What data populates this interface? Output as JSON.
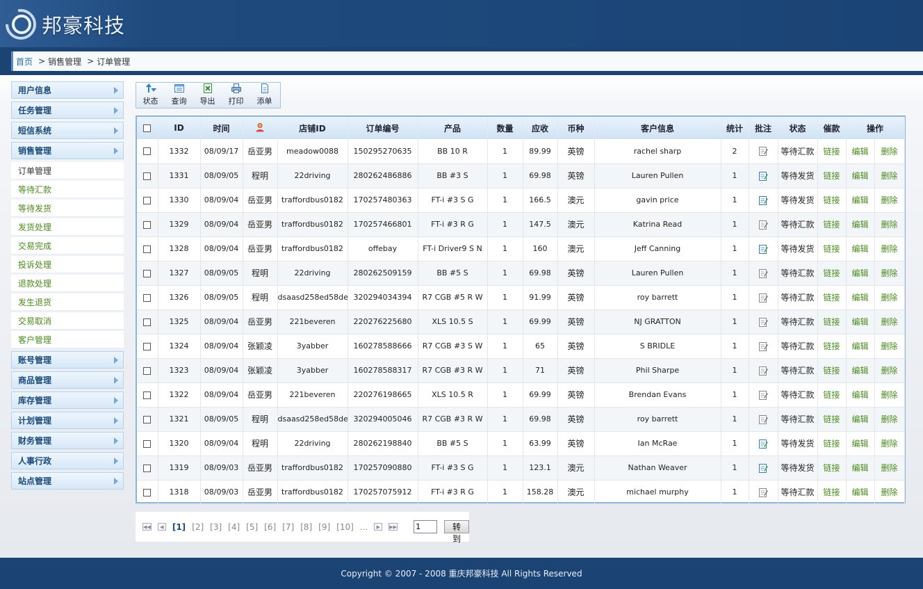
{
  "header": {
    "logo_text": "邦豪科技"
  },
  "breadcrumb": {
    "home": "首页",
    "sep": ">",
    "level1": "销售管理",
    "level2": "订单管理"
  },
  "sidebar": {
    "top_menus": [
      "用户信息",
      "任务管理",
      "短信系统",
      "销售管理"
    ],
    "sub_items": [
      "订单管理",
      "等待汇款",
      "等待发货",
      "发货处理",
      "交易完成",
      "投诉处理",
      "退款处理",
      "发生退货",
      "交易取消",
      "客户管理"
    ],
    "bottom_menus": [
      "账号管理",
      "商品管理",
      "库存管理",
      "计划管理",
      "财务管理",
      "人事行政",
      "站点管理"
    ]
  },
  "toolbar": {
    "status": "状态",
    "query": "查询",
    "export": "导出",
    "print": "打印",
    "add": "添单"
  },
  "table": {
    "headers": {
      "id": "ID",
      "time": "时间",
      "shop_id": "店铺ID",
      "order_no": "订单编号",
      "product": "产品",
      "qty": "数量",
      "receivable": "应收",
      "currency": "币种",
      "customer": "客户信息",
      "stats": "统计",
      "note": "批注",
      "status": "状态",
      "urge": "催款",
      "ops": "操作"
    },
    "rows": [
      {
        "id": "1332",
        "time": "08/09/17",
        "user": "岳亚男",
        "shop": "meadow0088",
        "order": "150295270635",
        "product": "BB 10 R",
        "qty": "1",
        "amount": "89.99",
        "currency": "英镑",
        "customer": "rachel sharp",
        "stats": "2",
        "note": "gray",
        "status": "等待汇款",
        "urge": "链接",
        "edit": "编辑",
        "del": "删除"
      },
      {
        "id": "1331",
        "time": "08/09/05",
        "user": "程明",
        "shop": "22driving",
        "order": "280262486886",
        "product": "BB #3 S",
        "qty": "1",
        "amount": "69.98",
        "currency": "英镑",
        "customer": "Lauren Pullen",
        "stats": "1",
        "note": "color",
        "status": "等待发货",
        "urge": "链接",
        "edit": "编辑",
        "del": "删除"
      },
      {
        "id": "1330",
        "time": "08/09/04",
        "user": "岳亚男",
        "shop": "traffordbus0182",
        "order": "170257480363",
        "product": "FT-i #3 S G",
        "qty": "1",
        "amount": "166.5",
        "currency": "澳元",
        "customer": "gavin price",
        "stats": "1",
        "note": "color",
        "status": "等待发货",
        "urge": "链接",
        "edit": "编辑",
        "del": "删除"
      },
      {
        "id": "1329",
        "time": "08/09/04",
        "user": "岳亚男",
        "shop": "traffordbus0182",
        "order": "170257466801",
        "product": "FT-i #3 R G",
        "qty": "1",
        "amount": "147.5",
        "currency": "澳元",
        "customer": "Katrina Read",
        "stats": "1",
        "note": "gray",
        "status": "等待汇款",
        "urge": "链接",
        "edit": "编辑",
        "del": "删除"
      },
      {
        "id": "1328",
        "time": "08/09/04",
        "user": "岳亚男",
        "shop": "traffordbus0182",
        "order": "offebay",
        "product": "FT-i Driver9 S N",
        "qty": "1",
        "amount": "160",
        "currency": "澳元",
        "customer": "Jeff Canning",
        "stats": "1",
        "note": "color",
        "status": "等待发货",
        "urge": "链接",
        "edit": "编辑",
        "del": "删除"
      },
      {
        "id": "1327",
        "time": "08/09/05",
        "user": "程明",
        "shop": "22driving",
        "order": "280262509159",
        "product": "BB #5 S",
        "qty": "1",
        "amount": "69.98",
        "currency": "英镑",
        "customer": "Lauren Pullen",
        "stats": "1",
        "note": "gray",
        "status": "等待汇款",
        "urge": "链接",
        "edit": "编辑",
        "del": "删除"
      },
      {
        "id": "1326",
        "time": "08/09/05",
        "user": "程明",
        "shop": "dsaasd258ed58de",
        "order": "320294034394",
        "product": "R7 CGB #5 R W",
        "qty": "1",
        "amount": "91.99",
        "currency": "英镑",
        "customer": "roy barrett",
        "stats": "1",
        "note": "gray",
        "status": "等待汇款",
        "urge": "链接",
        "edit": "编辑",
        "del": "删除"
      },
      {
        "id": "1325",
        "time": "08/09/04",
        "user": "岳亚男",
        "shop": "221beveren",
        "order": "220276225680",
        "product": "XLS 10.5 S",
        "qty": "1",
        "amount": "69.99",
        "currency": "英镑",
        "customer": "NJ GRATTON",
        "stats": "1",
        "note": "gray",
        "status": "等待汇款",
        "urge": "链接",
        "edit": "编辑",
        "del": "删除"
      },
      {
        "id": "1324",
        "time": "08/09/04",
        "user": "张颖凌",
        "shop": "3yabber",
        "order": "160278588666",
        "product": "R7 CGB #3 S W",
        "qty": "1",
        "amount": "65",
        "currency": "英镑",
        "customer": "S BRIDLE",
        "stats": "1",
        "note": "gray",
        "status": "等待汇款",
        "urge": "链接",
        "edit": "编辑",
        "del": "删除"
      },
      {
        "id": "1323",
        "time": "08/09/04",
        "user": "张颖凌",
        "shop": "3yabber",
        "order": "160278588317",
        "product": "R7 CGB #3 R W",
        "qty": "1",
        "amount": "71",
        "currency": "英镑",
        "customer": "Phil Sharpe",
        "stats": "1",
        "note": "gray",
        "status": "等待汇款",
        "urge": "链接",
        "edit": "编辑",
        "del": "删除"
      },
      {
        "id": "1322",
        "time": "08/09/04",
        "user": "岳亚男",
        "shop": "221beveren",
        "order": "220276198665",
        "product": "XLS 10.5 R",
        "qty": "1",
        "amount": "69.99",
        "currency": "英镑",
        "customer": "Brendan Evans",
        "stats": "1",
        "note": "gray",
        "status": "等待汇款",
        "urge": "链接",
        "edit": "编辑",
        "del": "删除"
      },
      {
        "id": "1321",
        "time": "08/09/05",
        "user": "程明",
        "shop": "dsaasd258ed58de",
        "order": "320294005046",
        "product": "R7 CGB #3 R W",
        "qty": "1",
        "amount": "69.98",
        "currency": "英镑",
        "customer": "roy barrett",
        "stats": "1",
        "note": "gray",
        "status": "等待汇款",
        "urge": "链接",
        "edit": "编辑",
        "del": "删除"
      },
      {
        "id": "1320",
        "time": "08/09/04",
        "user": "程明",
        "shop": "22driving",
        "order": "280262198840",
        "product": "BB #5 S",
        "qty": "1",
        "amount": "63.99",
        "currency": "英镑",
        "customer": "Ian McRae",
        "stats": "1",
        "note": "color",
        "status": "等待发货",
        "urge": "链接",
        "edit": "编辑",
        "del": "删除"
      },
      {
        "id": "1319",
        "time": "08/09/03",
        "user": "岳亚男",
        "shop": "traffordbus0182",
        "order": "170257090880",
        "product": "FT-i #3 S G",
        "qty": "1",
        "amount": "123.1",
        "currency": "澳元",
        "customer": "Nathan Weaver",
        "stats": "1",
        "note": "color",
        "status": "等待发货",
        "urge": "链接",
        "edit": "编辑",
        "del": "删除"
      },
      {
        "id": "1318",
        "time": "08/09/03",
        "user": "岳亚男",
        "shop": "traffordbus0182",
        "order": "170257075912",
        "product": "FT-i #3 R G",
        "qty": "1",
        "amount": "158.28",
        "currency": "澳元",
        "customer": "michael murphy",
        "stats": "1",
        "note": "gray",
        "status": "等待汇款",
        "urge": "链接",
        "edit": "编辑",
        "del": "删除"
      }
    ]
  },
  "pager": {
    "pages": [
      "[1]",
      "[2]",
      "[3]",
      "[4]",
      "[5]",
      "[6]",
      "[7]",
      "[8]",
      "[9]",
      "[10]"
    ],
    "ellipsis": "...",
    "input_value": "1",
    "go_label": "转到"
  },
  "footer": {
    "copyright": "Copyright © 2007 - 2008 重庆邦豪科技 All Rights Reserved"
  },
  "colors": {
    "header_bg": "#1b4475",
    "link_green": "#4b8a1e",
    "table_border": "#8fb4da"
  }
}
